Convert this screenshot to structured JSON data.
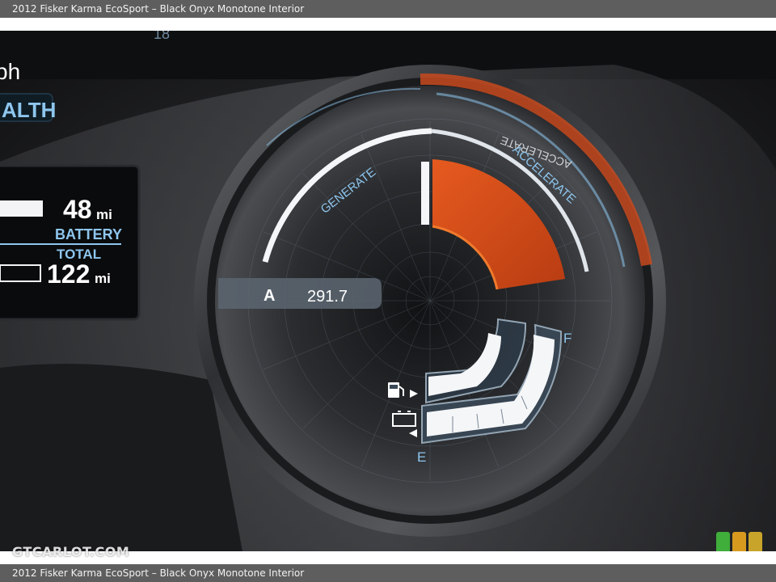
{
  "caption": "2012 Fisker Karma EcoSport – Black Onyx Monotone Interior",
  "watermark": "GTCARLOT.COM",
  "left_panel": {
    "speed_unit_partial": "ph",
    "partial_mode": "ALTH",
    "partial_top_number": "18",
    "battery_miles": "48",
    "battery_unit": "mi",
    "battery_label": "BATTERY",
    "total_label": "TOTAL",
    "total_miles": "122",
    "total_unit": "mi"
  },
  "gauge": {
    "generate_label": "GENERATE",
    "accelerate_label": "ACCELERATE",
    "reflected_label": "ACCELERATE",
    "odometer_mode": "A",
    "odometer_value": "291.7",
    "fuel_full_label": "F",
    "fuel_empty_label": "E",
    "accelerate_level": 0.35,
    "fuel_level": 0.85,
    "charge_level": 0.55
  },
  "colors": {
    "accent_orange": "#e0541c",
    "gauge_white": "#f4f6f8",
    "label_blue": "#8ec6ee",
    "panel_bg": "#121416"
  },
  "logo_colors": [
    "#3fae3a",
    "#d79a1f",
    "#c8a42a"
  ]
}
